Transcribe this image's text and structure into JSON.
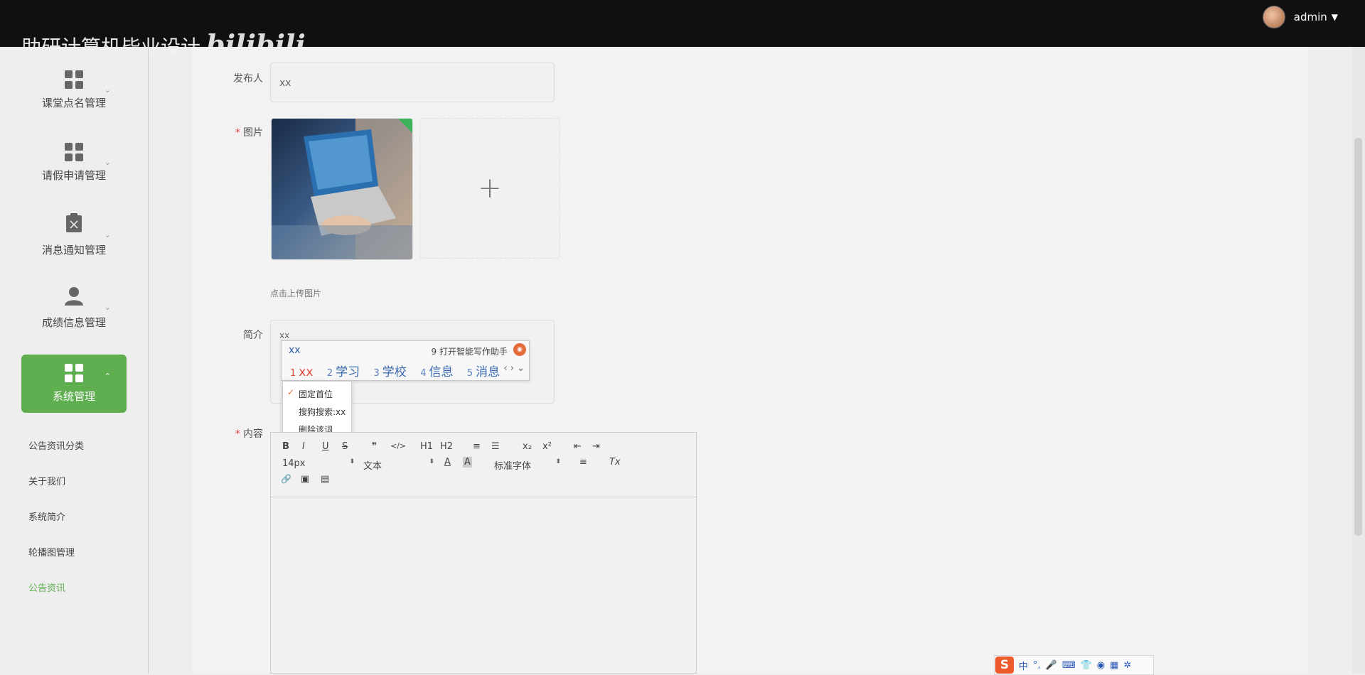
{
  "header": {
    "brand_text": "助研计算机毕业设计",
    "logo_text": "bilibili",
    "username": "admin",
    "dropdown_caret": "▼"
  },
  "sidebar": {
    "items": [
      {
        "label": "课堂点名管理",
        "icon": "grid-icon",
        "chevron": "⌄"
      },
      {
        "label": "请假申请管理",
        "icon": "grid-icon",
        "chevron": "⌄"
      },
      {
        "label": "消息通知管理",
        "icon": "clipboard-x-icon",
        "chevron": "⌄"
      },
      {
        "label": "成绩信息管理",
        "icon": "user-icon",
        "chevron": "⌄"
      },
      {
        "label": "系统管理",
        "icon": "grid-icon",
        "chevron": "⌃"
      }
    ],
    "subitems": [
      "公告资讯分类",
      "关于我们",
      "系统简介",
      "轮播图管理",
      "公告资讯"
    ],
    "active_color": "#5fae4f"
  },
  "form": {
    "publisher_label": "发布人",
    "publisher_value": "xx",
    "image_label": "图片",
    "upload_hint": "点击上传图片",
    "add_symbol": "+",
    "intro_label": "简介",
    "intro_value": "xx",
    "content_label": "内容",
    "required_mark": "*"
  },
  "ime": {
    "typed": "xx",
    "assistant": "9 打开智能写作助手",
    "candidates": [
      {
        "num": "1",
        "text": "xx"
      },
      {
        "num": "2",
        "text": "学习"
      },
      {
        "num": "3",
        "text": "学校"
      },
      {
        "num": "4",
        "text": "信息"
      },
      {
        "num": "5",
        "text": "消息"
      }
    ],
    "nav": "‹ › ⌄",
    "menu": {
      "check": "✓",
      "items": [
        "固定首位",
        "搜狗搜索:xx",
        "删除该词"
      ]
    }
  },
  "editor": {
    "row1": [
      "B",
      "I",
      "U",
      "S",
      "❞",
      "</>",
      "H1",
      "H2",
      "≡",
      "☰",
      "x₂",
      "x²",
      "⇤",
      "⇥"
    ],
    "font_size": "14px",
    "text_type": "文本",
    "font_family": "标准字体",
    "select_arrow": "⬍",
    "color_label": "A",
    "bg_label": "A",
    "align_icon": "≡",
    "clear_icon": "Tx",
    "row3": [
      "🔗",
      "▣",
      "▤"
    ]
  },
  "ime_status": {
    "logo": "S",
    "lang": "中",
    "punct": "°,",
    "mic": "🎤",
    "keyboard": "⌨",
    "skin": "👕",
    "toolbox": "◉",
    "apps": "▦",
    "settings": "✲"
  }
}
